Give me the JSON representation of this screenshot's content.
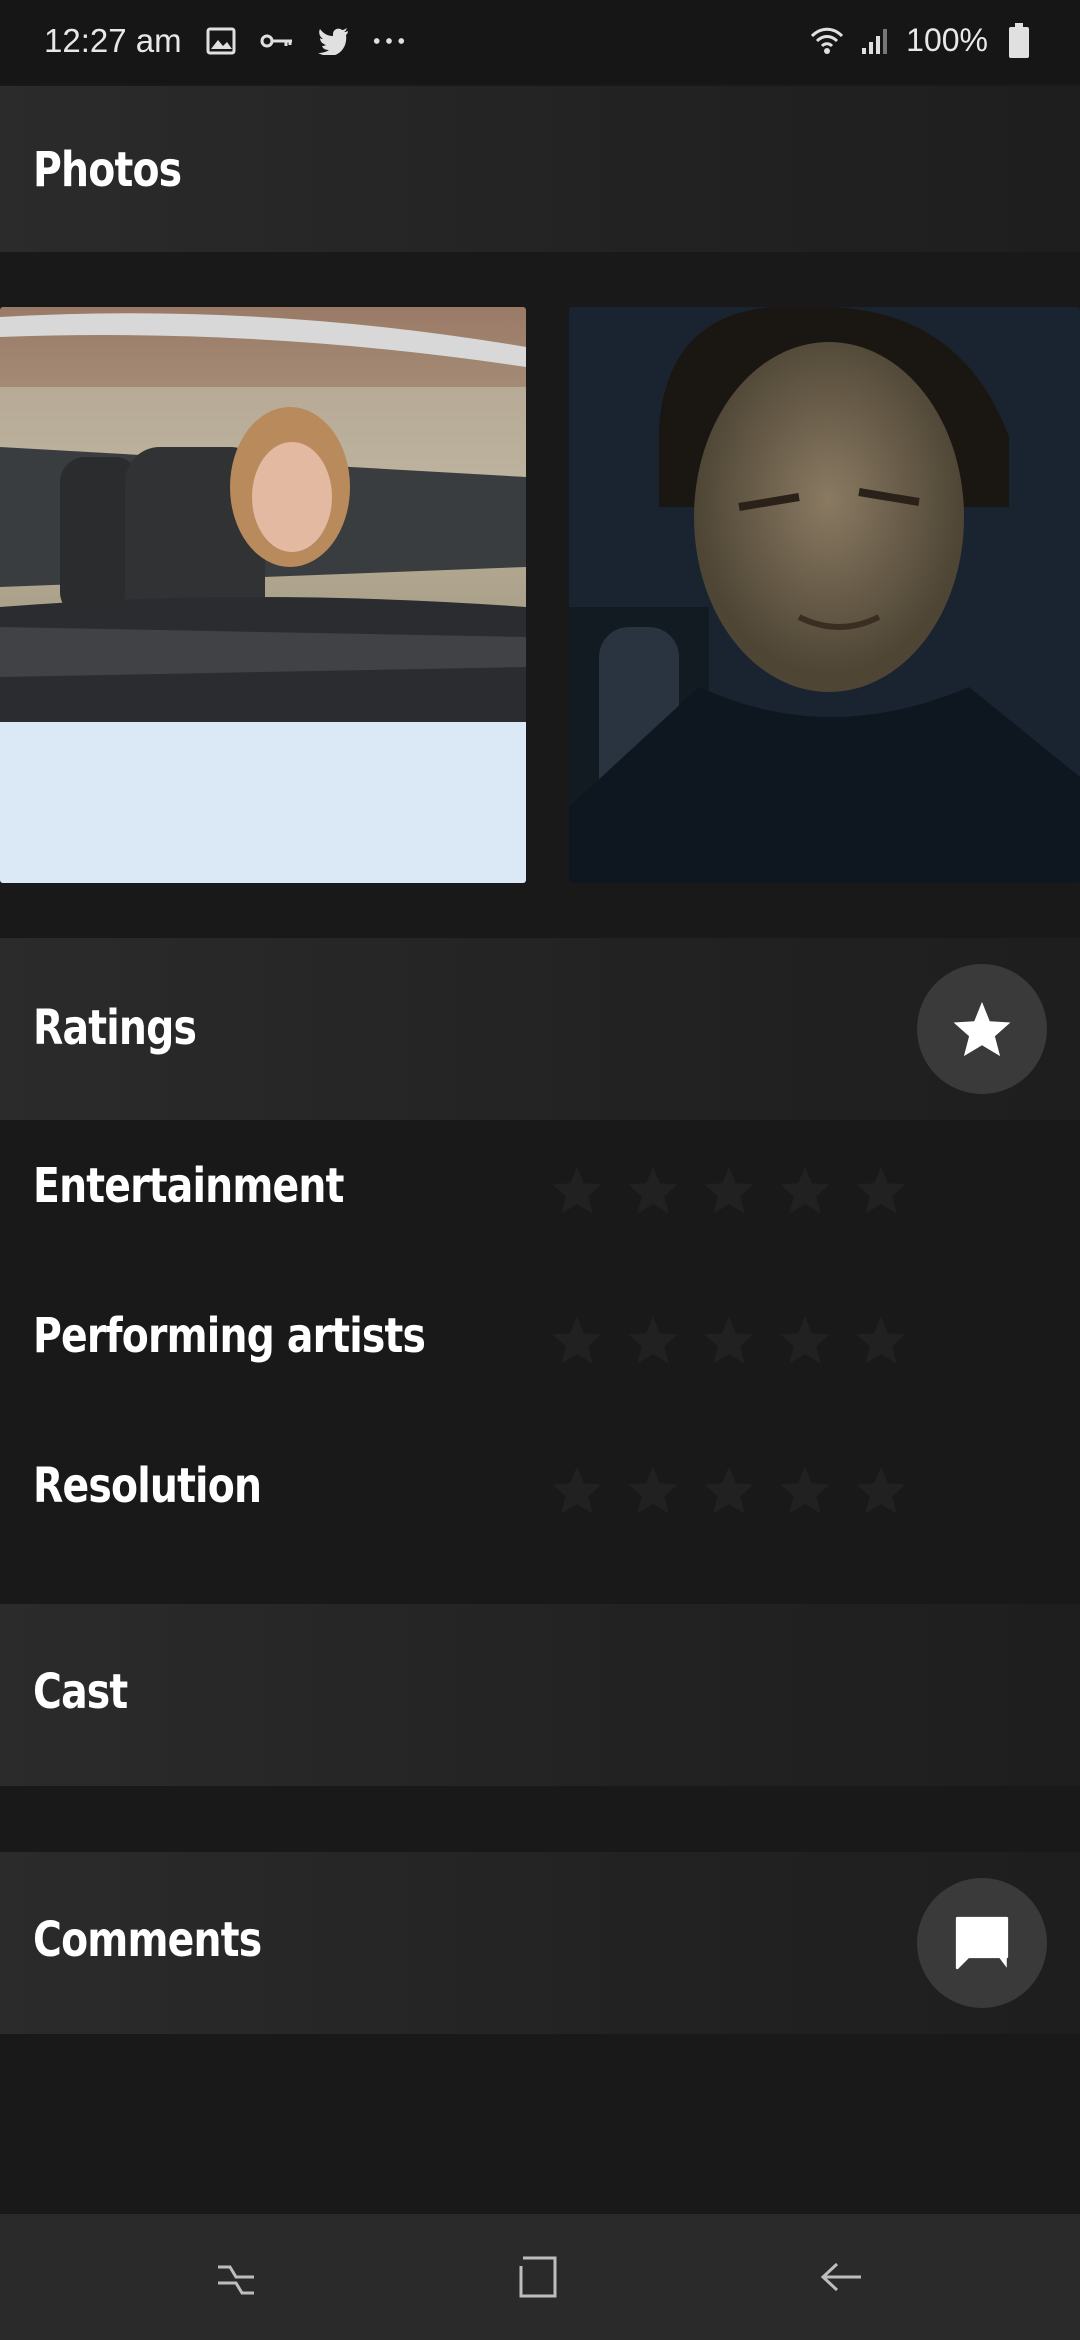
{
  "status_bar": {
    "time": "12:27 am",
    "battery": "100%",
    "icons": [
      "image-icon",
      "key-icon",
      "twitter-icon",
      "more-dots-icon",
      "wifi-icon",
      "signal-icon",
      "battery-icon"
    ]
  },
  "sections": {
    "photos_title": "Photos",
    "ratings_title": "Ratings",
    "cast_title": "Cast",
    "comments_title": "Comments"
  },
  "ratings": [
    {
      "label": "Entertainment",
      "stars": 0,
      "max": 5
    },
    {
      "label": "Performing artists",
      "stars": 0,
      "max": 5
    },
    {
      "label": "Resolution",
      "stars": 0,
      "max": 5
    }
  ],
  "colors": {
    "background": "#191919",
    "bar": "#262626",
    "fab": "#3a3a3a",
    "star_empty": "#212121"
  }
}
